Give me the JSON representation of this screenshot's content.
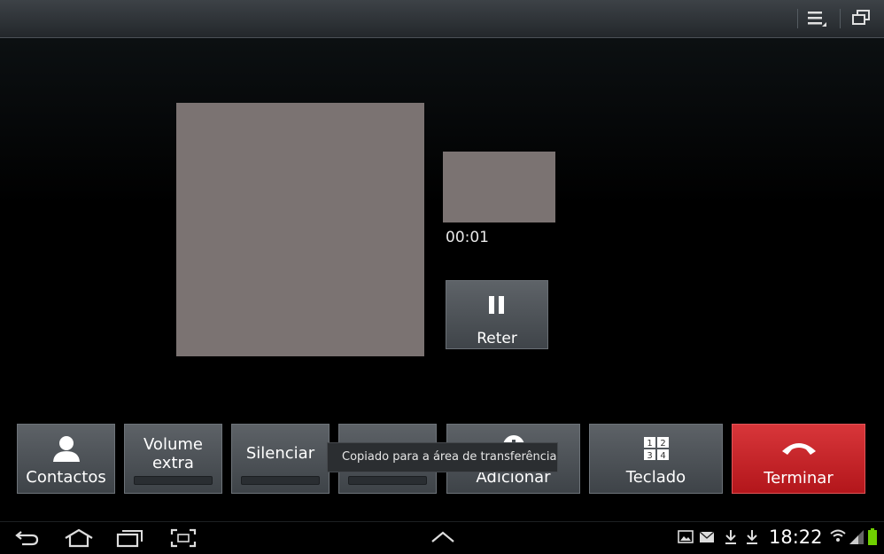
{
  "top_bar": {
    "icons": [
      "menu-icon",
      "restore-window-icon"
    ]
  },
  "call": {
    "timer": "00:01",
    "hold_label": "Reter"
  },
  "buttons": {
    "contacts": "Contactos",
    "volume_line1": "Volume",
    "volume_line2": "extra",
    "mute": "Silenciar",
    "add": "Adicionar",
    "keypad": "Teclado",
    "end": "Terminar"
  },
  "toast": "Copiado para a área de transferência",
  "status_bar": {
    "time": "18:22",
    "nav_icons": [
      "back-icon",
      "home-icon",
      "recent-apps-icon",
      "screenshot-icon",
      "up-arrow-icon"
    ],
    "notification_icons": [
      "gallery-icon",
      "email-icon",
      "download-icon",
      "download-icon",
      "wifi-icon",
      "signal-icon",
      "battery-icon"
    ]
  },
  "colors": {
    "end_call": "#c8262b",
    "battery": "#6fd000",
    "placeholder": "#7b7372"
  }
}
